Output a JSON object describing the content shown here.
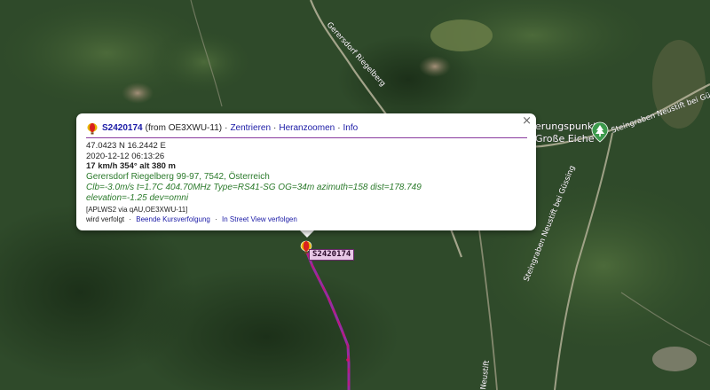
{
  "map": {
    "roads": {
      "top": "Gerersdorf Riegelberg",
      "right_top": "Steingraben Neustift bei Güssing",
      "right_mid": "Steingraben Neustift bei Güssing",
      "bottom_right": "Neustift"
    },
    "poi": {
      "line1": "erungspunkt",
      "line2": "Große Eiche",
      "icon": "tree-pin-icon"
    }
  },
  "popup": {
    "callsign": "S2420174",
    "from": "(from OE3XWU-11)",
    "links": [
      "Zentrieren",
      "Heranzoomen",
      "Info"
    ],
    "separator": "·",
    "coords": "47.0423 N 16.2442 E",
    "timestamp": "2020-12-12 06:13:26",
    "speed": "17 km/h 354° alt 380 m",
    "address": "Gerersdorf Riegelberg 99-97, 7542, Österreich",
    "comment1": "Clb=-3.0m/s t=1.7C 404.70MHz Type=RS41-SG OG=34m azimuth=158 dist=178.749",
    "comment2": "elevation=-1.25 dev=omni",
    "path": "[APLWS2 via qAU,OE3XWU-11]",
    "follow_prefix": "wird verfolgt",
    "follow_stop": "Beende Kursverfolgung",
    "follow_street": "In Street View verfolgen",
    "close": "×"
  },
  "marker": {
    "label": "S2420174",
    "icon": "balloon-icon"
  },
  "colors": {
    "track": "#9a2aa0",
    "track_alt": "#d0106a",
    "accent_link": "#1a1aa6",
    "comment": "#2b7a2b"
  }
}
